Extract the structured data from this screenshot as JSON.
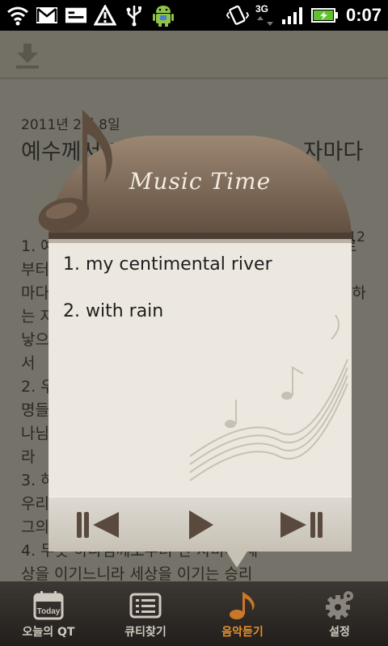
{
  "status_bar": {
    "time": "0:07",
    "network": "3G",
    "icons": [
      "wifi-icon",
      "gmail-icon",
      "sms-icon",
      "alert-icon",
      "usb-icon",
      "android-icon",
      "vibrate-icon",
      "signal-icon",
      "battery-icon"
    ]
  },
  "toolbar": {
    "download_icon": "download-icon"
  },
  "document": {
    "date": "2011년 2월 8일",
    "title": "예수께서 그리스도이심을 믿는 자마다",
    "reference": "12",
    "body": "1. 예수께서 그리스도이심을 믿는 자마다 하나님께로부터 난 자니 또한\n마다 하나님께로부터 난 자니 또한 낳으신 이를 사랑하는 자마다 그에게서\n낳으신 자를 사랑하느니라\n서\n2. 우리가 하나님을 사랑하고 그의 계\n명들을 지킬 때에 이로써 하나님의 자\n나님을 사랑하는 것을 아느니\n라\n3. 하나님을 사랑하는 것은 이것이니\n우리가 그의 계명들을 지키는 것이라\n그의 계명들은 무거운 것이 아니로다\n4. 무릇 하나님께로부터 난 자마다 세\n상을 이기느니라 세상을 이기는 승리\n는 이것이니 우리의 믿음이니라"
  },
  "player": {
    "title": "Music Time",
    "songs": [
      "1. my centimental river",
      "2. with rain"
    ],
    "controls": [
      "previous-button",
      "play-button",
      "next-button"
    ],
    "accent": "#5e4c3e"
  },
  "bottom_nav": {
    "items": [
      {
        "label": "오늘의 QT",
        "icon": "calendar-icon",
        "active": false
      },
      {
        "label": "큐티찾기",
        "icon": "list-icon",
        "active": false
      },
      {
        "label": "음악듣기",
        "icon": "music-note-icon",
        "active": true
      },
      {
        "label": "설정",
        "icon": "gear-icon",
        "active": false
      }
    ],
    "active_color": "#e6922d"
  }
}
